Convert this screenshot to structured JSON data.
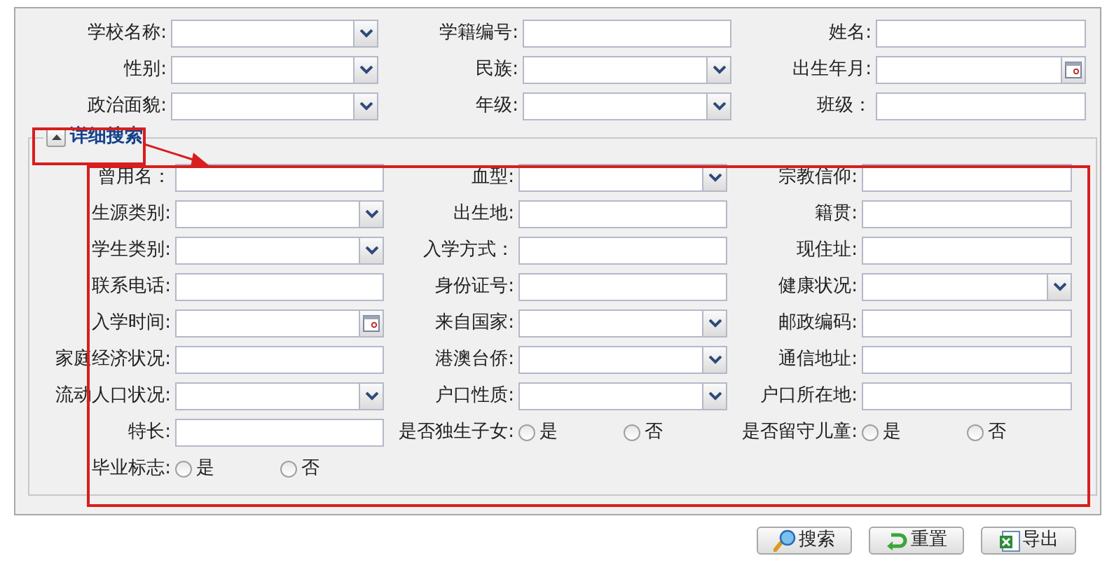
{
  "search_fields": [
    {
      "label": "学校名称:",
      "kind": "select"
    },
    {
      "label": "学籍编号:",
      "kind": "text"
    },
    {
      "label": "姓名:",
      "kind": "text"
    },
    {
      "label": "性别:",
      "kind": "select"
    },
    {
      "label": "民族:",
      "kind": "select"
    },
    {
      "label": "出生年月:",
      "kind": "date"
    },
    {
      "label": "政治面貌:",
      "kind": "select"
    },
    {
      "label": "年级:",
      "kind": "select"
    },
    {
      "label": "班级：",
      "kind": "text"
    }
  ],
  "detail_section": {
    "title": "详细搜索",
    "expanded": true,
    "fields": [
      {
        "label": "曾用名：",
        "kind": "text"
      },
      {
        "label": "血型:",
        "kind": "select"
      },
      {
        "label": "宗教信仰:",
        "kind": "text"
      },
      {
        "label": "生源类别:",
        "kind": "select"
      },
      {
        "label": "出生地:",
        "kind": "text"
      },
      {
        "label": "籍贯:",
        "kind": "text"
      },
      {
        "label": "学生类别:",
        "kind": "select"
      },
      {
        "label": "入学方式：",
        "kind": "text"
      },
      {
        "label": "现住址:",
        "kind": "text"
      },
      {
        "label": "联系电话:",
        "kind": "text"
      },
      {
        "label": "身份证号:",
        "kind": "text"
      },
      {
        "label": "健康状况:",
        "kind": "select"
      },
      {
        "label": "入学时间:",
        "kind": "date"
      },
      {
        "label": "来自国家:",
        "kind": "select"
      },
      {
        "label": "邮政编码:",
        "kind": "text"
      },
      {
        "label": "家庭经济状况:",
        "kind": "text"
      },
      {
        "label": "港澳台侨:",
        "kind": "select"
      },
      {
        "label": "通信地址:",
        "kind": "text"
      },
      {
        "label": "流动人口状况:",
        "kind": "select"
      },
      {
        "label": "户口性质:",
        "kind": "select"
      },
      {
        "label": "户口所在地:",
        "kind": "text"
      },
      {
        "label": "特长:",
        "kind": "text"
      },
      {
        "label": "是否独生子女:",
        "kind": "radio",
        "options": [
          {
            "label": "是",
            "selected": false
          },
          {
            "label": "否",
            "selected": false
          }
        ]
      },
      {
        "label": "是否留守儿童:",
        "kind": "radio",
        "options": [
          {
            "label": "是",
            "selected": false
          },
          {
            "label": "否",
            "selected": false
          }
        ]
      },
      {
        "label": "毕业标志:",
        "kind": "radio",
        "options": [
          {
            "label": "是",
            "selected": false
          },
          {
            "label": "否",
            "selected": false
          }
        ]
      }
    ]
  },
  "buttons": [
    {
      "label": "搜索",
      "kind": "search"
    },
    {
      "label": "重置",
      "kind": "reset"
    },
    {
      "label": "导出",
      "kind": "export"
    }
  ]
}
